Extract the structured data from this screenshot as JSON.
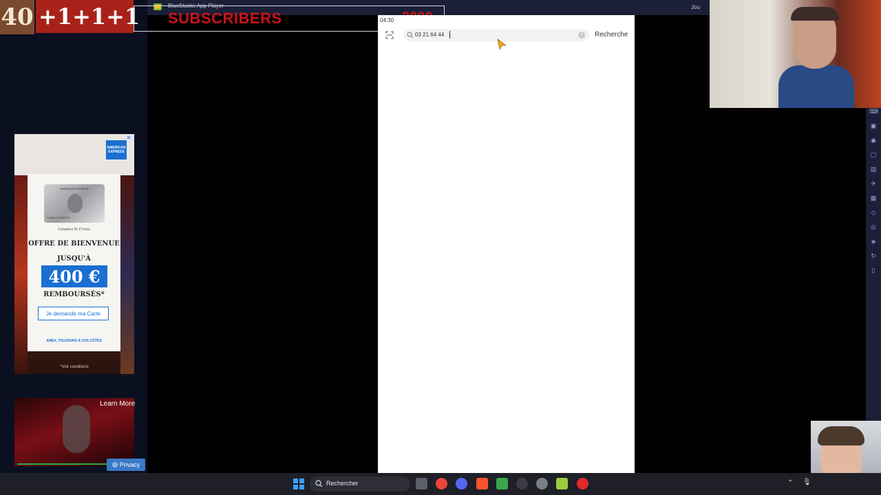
{
  "overlay": {
    "counter": "40",
    "plus_one": [
      "+1",
      "+1",
      "+1"
    ],
    "subscribers_label": "SUBSCRIBERS",
    "subscribers_goal": "2000"
  },
  "bluestacks": {
    "window_title": "BlueStacks App Player",
    "top_right_label": "Jou",
    "toolbar_icons": [
      "keyboard-icon",
      "screenshot-icon",
      "camera-icon",
      "record-icon",
      "folder-icon",
      "airplane-icon",
      "files-icon",
      "eco-icon",
      "location-icon",
      "layers-icon",
      "sync-icon",
      "more-icon"
    ]
  },
  "phone": {
    "status_time": "04:30",
    "search": {
      "value": "03 21 64 44",
      "button_label": "Recherche"
    }
  },
  "ad": {
    "brand": "AMERICAN EXPRESS",
    "close_label": "✕",
    "card_caption": "Cotisation 55 €*/mois",
    "card_holder": "CAMILLE MARTIN",
    "offer_line1": "OFFRE DE BIENVENUE",
    "offer_line2": "JUSQU'À",
    "amount": "400 €",
    "offer_line3": "REMBOURSÉS*",
    "cta": "Je demande ma Carte",
    "tagline": "AMEX, TOUJOURS À VOS CÔTÉS",
    "conditions": "*Voir conditions"
  },
  "video_ad": {
    "learn_more": "Learn More",
    "privacy": "Privacy"
  },
  "taskbar": {
    "search_placeholder": "Rechercher",
    "apps": [
      {
        "name": "file-explorer-icon",
        "color": "#5a5f6b"
      },
      {
        "name": "chrome-icon",
        "color": "#e8453c"
      },
      {
        "name": "discord-icon",
        "color": "#5865f2"
      },
      {
        "name": "brave-icon",
        "color": "#fb542b"
      },
      {
        "name": "excel-icon",
        "color": "#3ba74a"
      },
      {
        "name": "app-icon",
        "color": "#3b3b44"
      },
      {
        "name": "settings-icon",
        "color": "#7a7f8a"
      },
      {
        "name": "bluestacks-icon",
        "color": "#9bcb3c"
      },
      {
        "name": "youtube-icon",
        "color": "#e02b2b"
      }
    ]
  }
}
